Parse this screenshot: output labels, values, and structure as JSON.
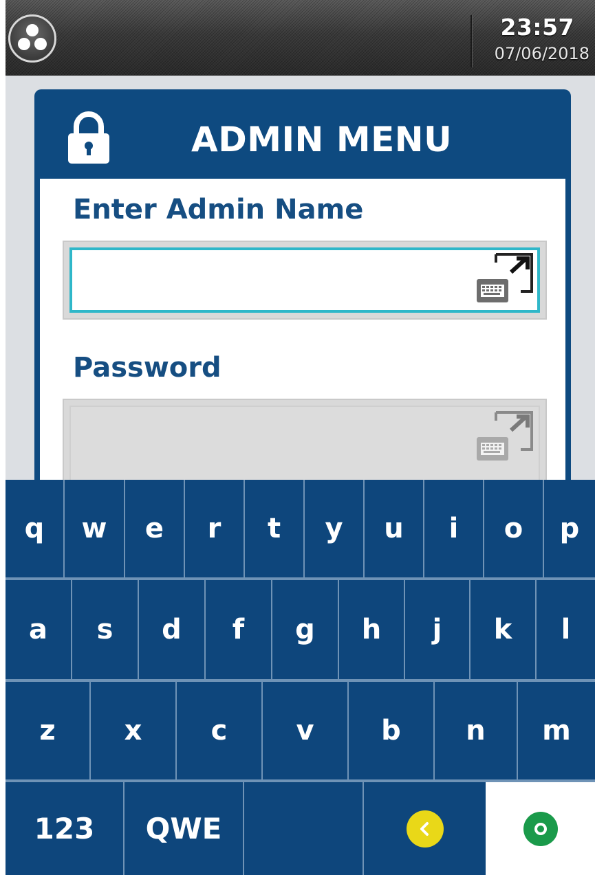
{
  "status_bar": {
    "time": "23:57",
    "date": "07/06/2018",
    "home_icon": "home-dots-icon"
  },
  "dialog": {
    "title": "ADMIN MENU",
    "title_icon": "lock-icon",
    "admin_name": {
      "label": "Enter Admin Name",
      "value": "",
      "keyboard_icon": "keyboard-expand-icon"
    },
    "password": {
      "label": "Password",
      "value": "",
      "keyboard_icon": "keyboard-expand-icon"
    }
  },
  "keyboard": {
    "row1": [
      "q",
      "w",
      "e",
      "r",
      "t",
      "y",
      "u",
      "i",
      "o",
      "p"
    ],
    "row2": [
      "a",
      "s",
      "d",
      "f",
      "g",
      "h",
      "j",
      "k",
      "l"
    ],
    "row3": [
      "z",
      "x",
      "c",
      "v",
      "b",
      "n",
      "m"
    ],
    "row4": {
      "numbers_label": "123",
      "qwerty_label": "QWE",
      "backspace_icon": "backspace-icon",
      "enter_icon": "confirm-icon"
    }
  },
  "colors": {
    "primary": "#0e467c",
    "accent_focus": "#2fb7c9",
    "backspace": "#e9d818",
    "confirm": "#1a9a4a"
  }
}
